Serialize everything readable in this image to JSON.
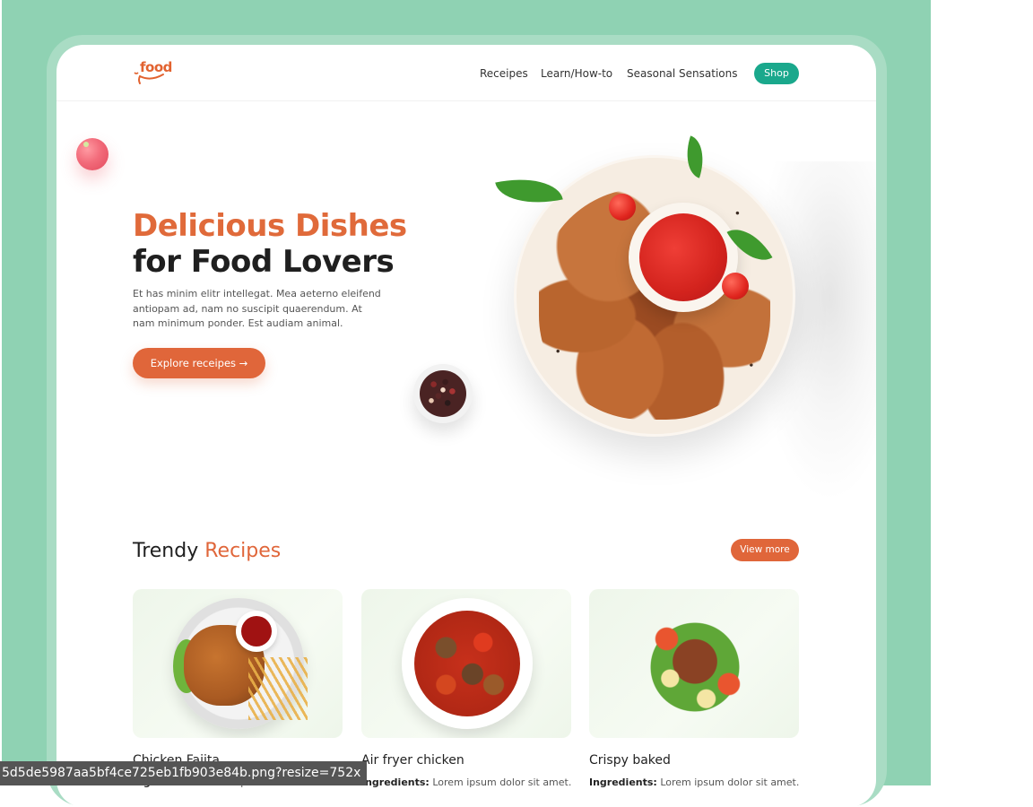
{
  "nav": {
    "logo": "food",
    "links": [
      "Receipes",
      "Learn/How-to",
      "Seasonal Sensations"
    ],
    "shop": "Shop"
  },
  "hero": {
    "title_line1": "Delicious Dishes",
    "title_line2": "for Food Lovers",
    "description": "Et has minim elitr intellegat. Mea aeterno eleifend antiopam ad, nam no suscipit quaerendum. At nam minimum ponder. Est audiam animal.",
    "cta": "Explore receipes →"
  },
  "trendy": {
    "title_plain": "Trendy ",
    "title_accent": "Recipes",
    "view_more": "View more",
    "cards": [
      {
        "title": "Chicken Fajita",
        "ing_label": "Ingredients:",
        "ing_text": " Lorem ipsum dolor sit amet."
      },
      {
        "title": "Air fryer chicken",
        "ing_label": "Ingredients:",
        "ing_text": " Lorem ipsum dolor sit amet."
      },
      {
        "title": "Crispy baked",
        "ing_label": "Ingredients:",
        "ing_text": " Lorem ipsum dolor sit amet."
      }
    ]
  },
  "status_url": "5d5de5987aa5bf4ce725eb1fb903e84b.png?resize=752x",
  "colors": {
    "background": "#8fd2b3",
    "accent": "#e0663a",
    "shop": "#1aa88c",
    "text": "#1f1f1f"
  },
  "icons": [
    "tomato",
    "pepper-bowl",
    "chicken-wings-plate",
    "arrow-right-icon"
  ]
}
